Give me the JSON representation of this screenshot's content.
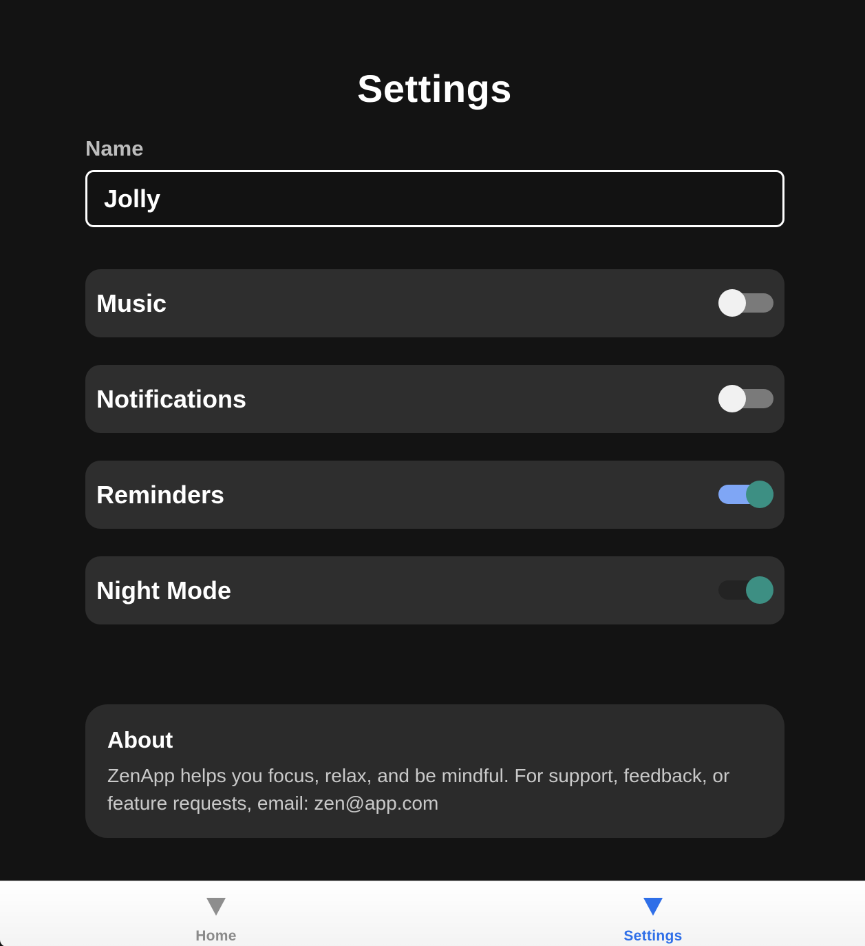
{
  "page": {
    "title": "Settings"
  },
  "name_field": {
    "label": "Name",
    "value": "Jolly"
  },
  "settings": [
    {
      "label": "Music",
      "enabled": false
    },
    {
      "label": "Notifications",
      "enabled": false
    },
    {
      "label": "Reminders",
      "enabled": true
    },
    {
      "label": "Night Mode",
      "enabled": true
    }
  ],
  "about": {
    "title": "About",
    "text": "ZenApp helps you focus, relax, and be mindful. For support, feedback, or feature requests, email: zen@app.com"
  },
  "tab_bar": {
    "tabs": [
      {
        "label": "Home",
        "icon": "triangle-down-icon",
        "active": false
      },
      {
        "label": "Settings",
        "icon": "triangle-down-icon",
        "active": true
      }
    ]
  },
  "colors": {
    "background": "#131313",
    "card": "#2e2e2e",
    "accent_blue": "#2f6fe8",
    "toggle_on_thumb": "#3d8f83",
    "toggle_on_track": "#7fa6f5"
  }
}
